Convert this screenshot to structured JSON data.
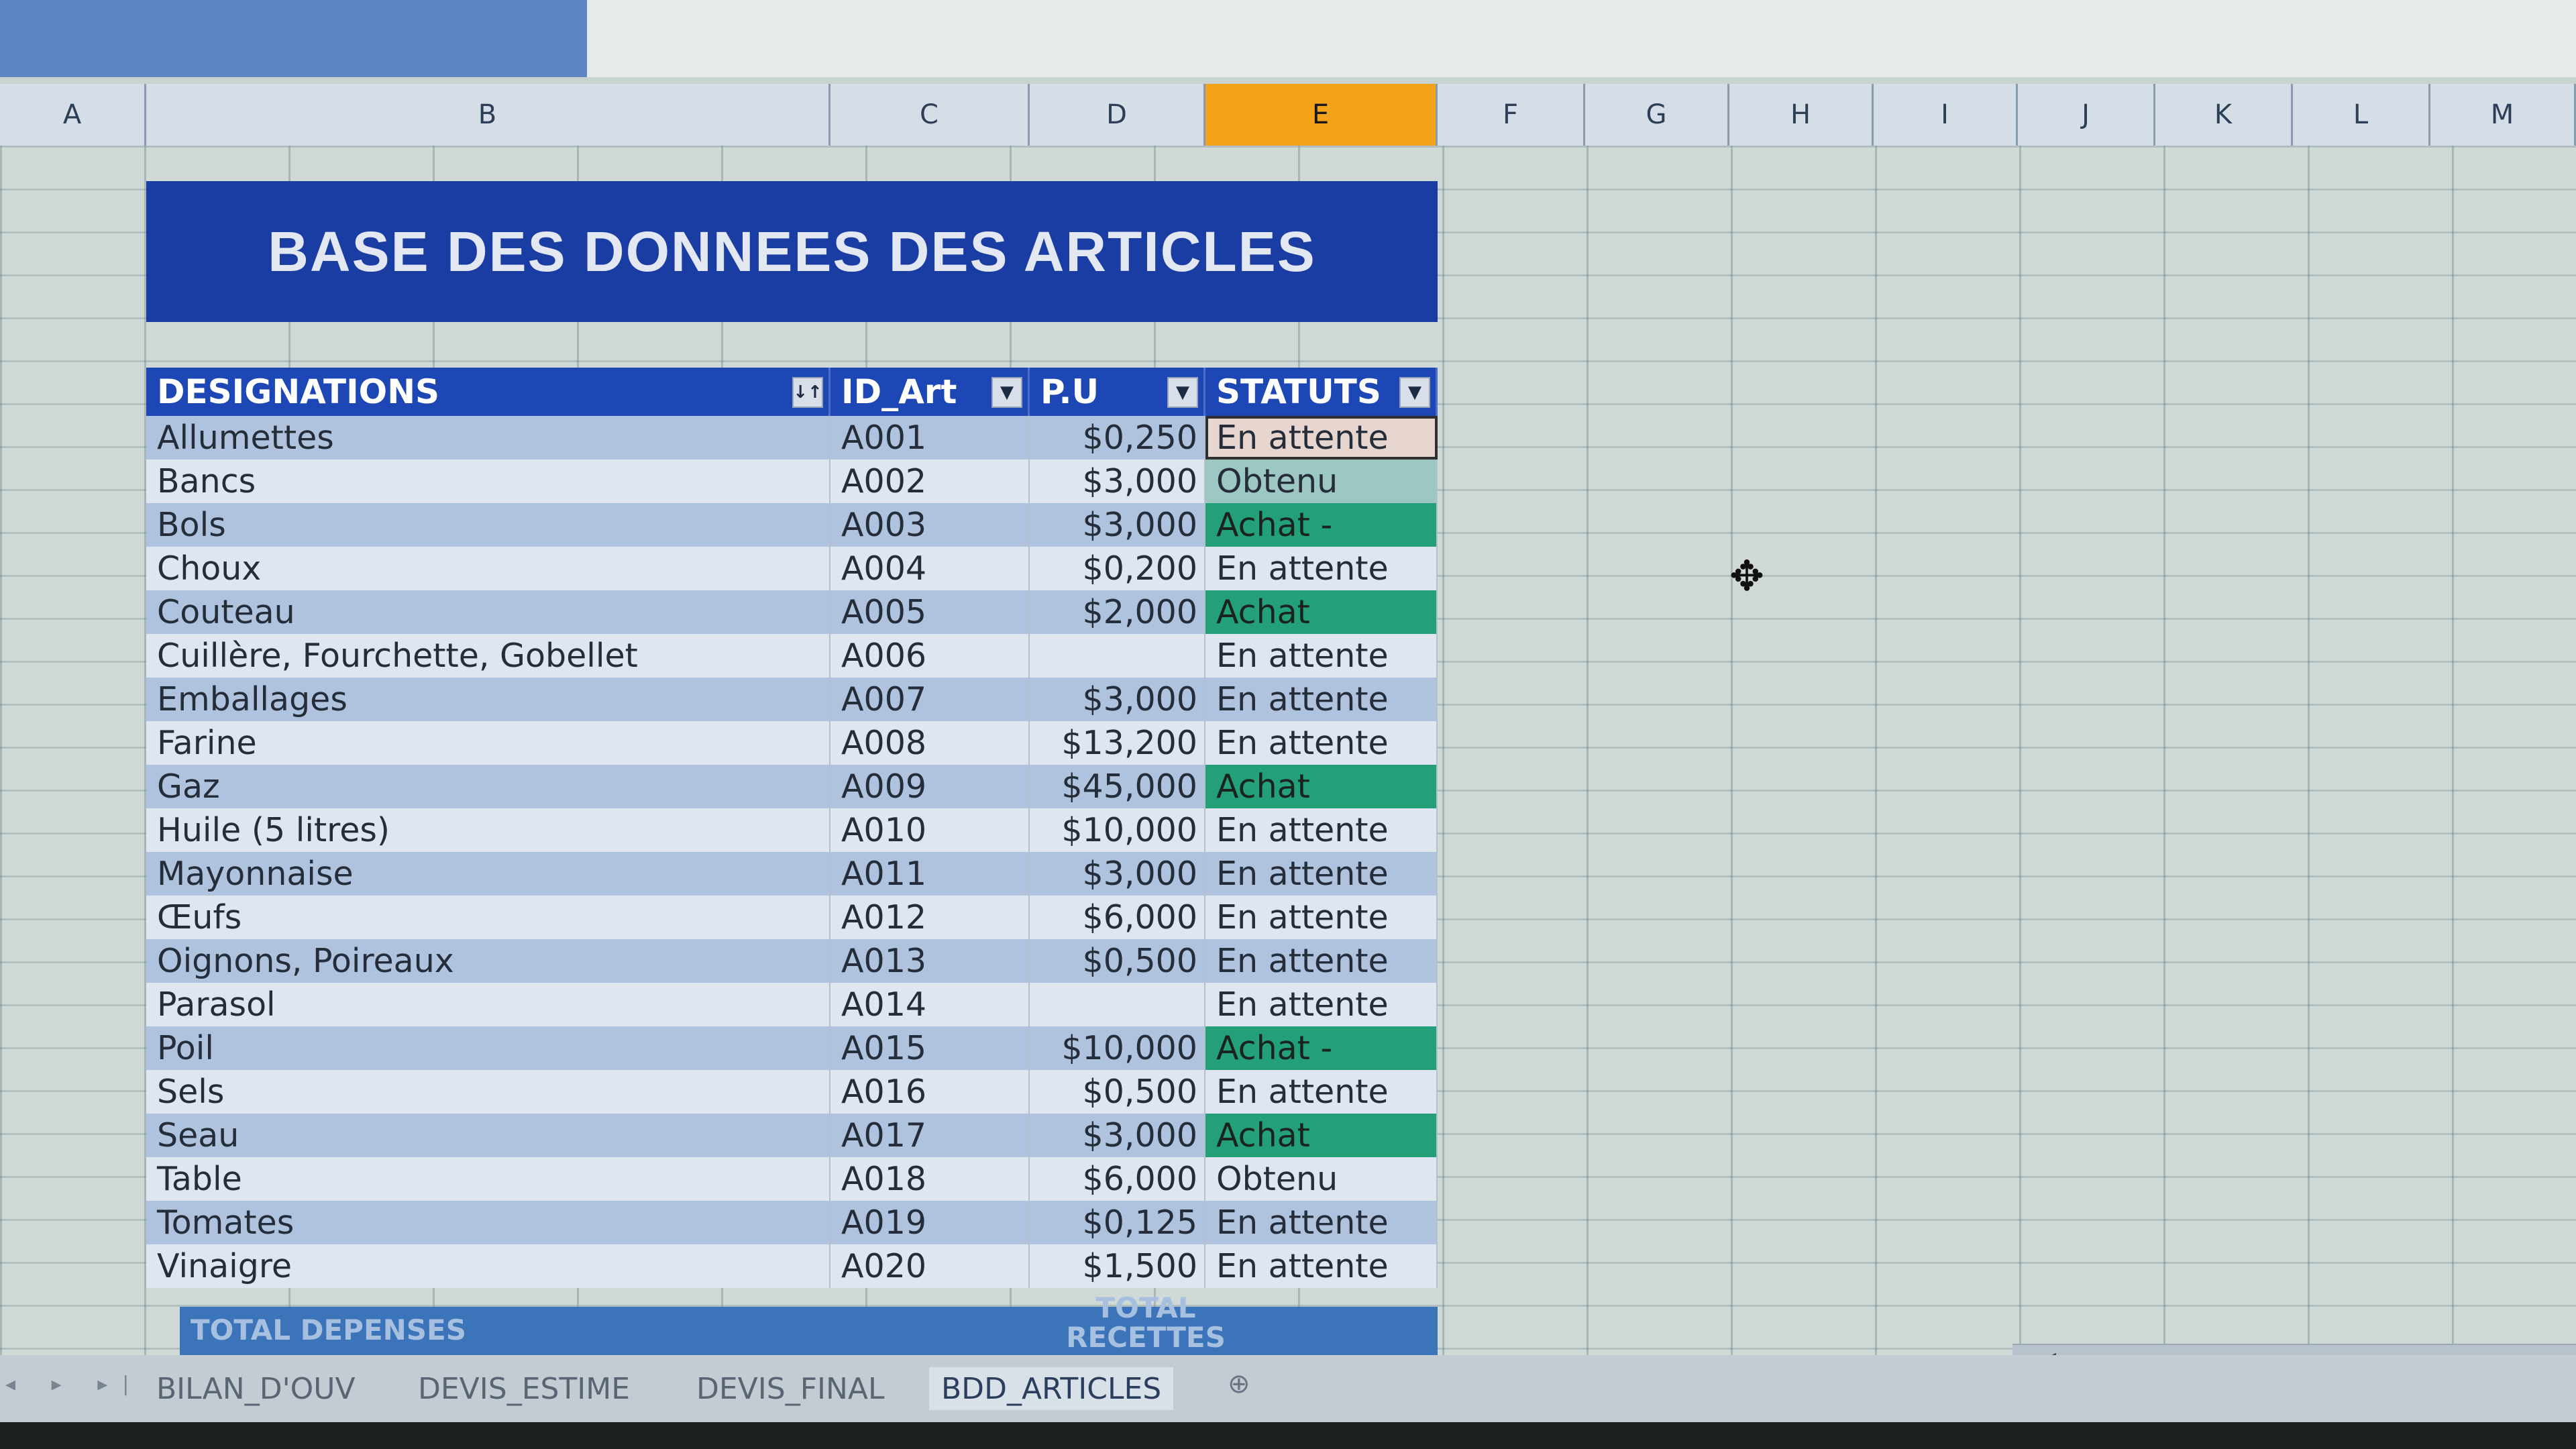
{
  "columns": [
    "A",
    "B",
    "C",
    "D",
    "E",
    "F",
    "G",
    "H",
    "I",
    "J",
    "K",
    "L",
    "M"
  ],
  "title": "BASE DES DONNEES DES ARTICLES",
  "headers": {
    "designations": "DESIGNATIONS",
    "id": "ID_Art",
    "pu": "P.U",
    "statuts": "STATUTS"
  },
  "filter_icons": {
    "designations": "↓↑",
    "other": "▼"
  },
  "rows": [
    {
      "name": "Allumettes",
      "id": "A001",
      "pu": "$0,250",
      "status": "En attente",
      "type": "wait",
      "selected": true
    },
    {
      "name": "Bancs",
      "id": "A002",
      "pu": "$3,000",
      "status": "Obtenu",
      "type": "ok"
    },
    {
      "name": "Bols",
      "id": "A003",
      "pu": "$3,000",
      "status": "Achat -",
      "type": "buy"
    },
    {
      "name": "Choux",
      "id": "A004",
      "pu": "$0,200",
      "status": "En attente",
      "type": "plain"
    },
    {
      "name": "Couteau",
      "id": "A005",
      "pu": "$2,000",
      "status": "Achat",
      "type": "buy"
    },
    {
      "name": "Cuillère, Fourchette, Gobellet",
      "id": "A006",
      "pu": "",
      "status": "En attente",
      "type": "plain"
    },
    {
      "name": "Emballages",
      "id": "A007",
      "pu": "$3,000",
      "status": "En attente",
      "type": "plain"
    },
    {
      "name": "Farine",
      "id": "A008",
      "pu": "$13,200",
      "status": "En attente",
      "type": "plain"
    },
    {
      "name": "Gaz",
      "id": "A009",
      "pu": "$45,000",
      "status": "Achat",
      "type": "buy"
    },
    {
      "name": "Huile (5 litres)",
      "id": "A010",
      "pu": "$10,000",
      "status": "En attente",
      "type": "plain"
    },
    {
      "name": "Mayonnaise",
      "id": "A011",
      "pu": "$3,000",
      "status": "En attente",
      "type": "plain"
    },
    {
      "name": "Œufs",
      "id": "A012",
      "pu": "$6,000",
      "status": "En attente",
      "type": "plain"
    },
    {
      "name": "Oignons, Poireaux",
      "id": "A013",
      "pu": "$0,500",
      "status": "En attente",
      "type": "plain"
    },
    {
      "name": "Parasol",
      "id": "A014",
      "pu": "",
      "status": "En attente",
      "type": "plain"
    },
    {
      "name": "Poil",
      "id": "A015",
      "pu": "$10,000",
      "status": "Achat -",
      "type": "buy"
    },
    {
      "name": "Sels",
      "id": "A016",
      "pu": "$0,500",
      "status": "En attente",
      "type": "plain"
    },
    {
      "name": "Seau",
      "id": "A017",
      "pu": "$3,000",
      "status": "Achat",
      "type": "buy"
    },
    {
      "name": "Table",
      "id": "A018",
      "pu": "$6,000",
      "status": "Obtenu",
      "type": "plain"
    },
    {
      "name": "Tomates",
      "id": "A019",
      "pu": "$0,125",
      "status": "En attente",
      "type": "plain"
    },
    {
      "name": "Vinaigre",
      "id": "A020",
      "pu": "$1,500",
      "status": "En attente",
      "type": "plain"
    }
  ],
  "totals": {
    "depenses": "TOTAL DEPENSES",
    "recettes_line1": "TOTAL",
    "recettes_line2": "RECETTES"
  },
  "sheet_tabs": [
    "BILAN_D'OUV",
    "DEVIS_ESTIME",
    "DEVIS_FINAL",
    "BDD_ARTICLES"
  ],
  "active_tab": "BDD_ARTICLES",
  "nav_arrows": "◂ ▸ ▸|",
  "new_sheet_icon": "new-sheet-icon",
  "cursor_icon": "move-cursor-icon",
  "colors": {
    "title_bg": "#1a3da3",
    "header_bg": "#1d47b5",
    "status_buy": "#23a079",
    "status_ok": "#9cc7c3",
    "status_wait": "#e7d6d0",
    "active_col": "#f2a31a"
  }
}
